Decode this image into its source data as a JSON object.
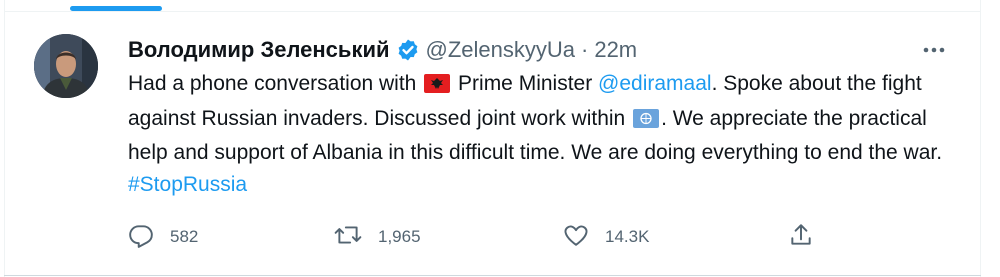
{
  "tweet": {
    "display_name": "Володимир Зеленський",
    "handle": "@ZelenskyyUa",
    "separator": "·",
    "time": "22m",
    "text": {
      "t1": "Had a phone conversation with ",
      "flag_1": "albania-flag-emoji",
      "t2": " Prime Minister ",
      "mention": "@ediramaal",
      "t3": ". Spoke about the fight against Russian invaders. Discussed joint work within ",
      "flag_2": "united-nations-flag-emoji",
      "t4": ". We appreciate the practical help and support of Albania in this difficult time. We are doing everything to end the war. ",
      "hashtag": "#StopRussia"
    }
  },
  "actions": {
    "replies": "582",
    "retweets": "1,965",
    "likes": "14.3K"
  },
  "colors": {
    "accent": "#1d9bf0",
    "text": "#0f1419",
    "secondary": "#536471"
  }
}
